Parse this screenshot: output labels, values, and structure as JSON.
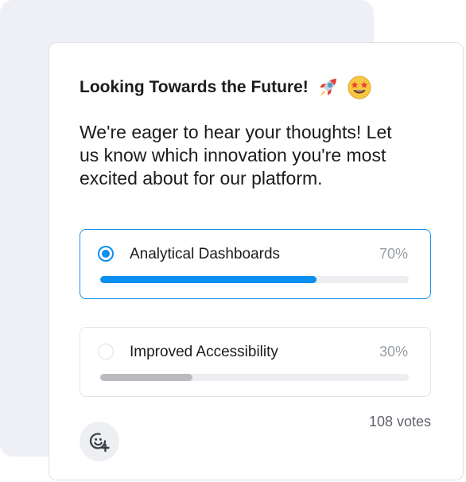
{
  "poll": {
    "title": "Looking Towards the Future!",
    "question": "We're eager to hear your thoughts! Let us know which innovation you're most excited about for our platform.",
    "emojis": [
      "rocket-icon",
      "star-struck-face-icon"
    ],
    "options": [
      {
        "label": "Analytical Dashboards",
        "percent_label": "70%",
        "percent": 70,
        "selected": true,
        "bar_color": "#0a8ff0"
      },
      {
        "label": "Improved Accessibility",
        "percent_label": "30%",
        "percent": 30,
        "selected": false,
        "bar_color": "#b9bbbf"
      }
    ],
    "votes_label": "108 votes"
  },
  "colors": {
    "accent": "#0a8ff0",
    "back_card": "#eff0f5"
  }
}
